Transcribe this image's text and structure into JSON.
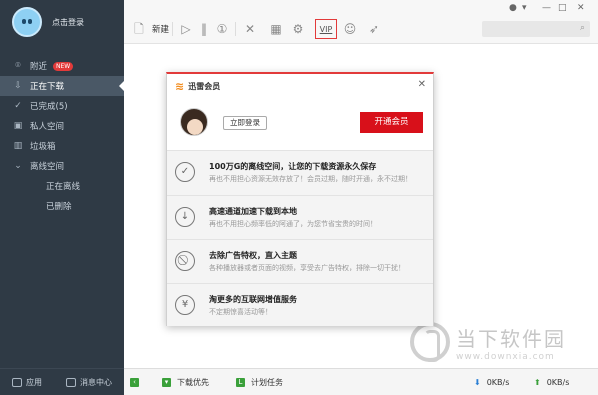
{
  "sidebar": {
    "login_label": "点击登录",
    "items": [
      {
        "label": "附近",
        "badge": "NEW",
        "icon": "location-icon"
      },
      {
        "label": "正在下载",
        "icon": "download-icon"
      },
      {
        "label": "已完成(5)",
        "icon": "check-icon"
      },
      {
        "label": "私人空间",
        "icon": "lock-icon"
      },
      {
        "label": "垃圾箱",
        "icon": "trash-icon"
      },
      {
        "label": "离线空间",
        "icon": "chevron-down-icon"
      },
      {
        "label": "正在离线"
      },
      {
        "label": "已删除"
      }
    ],
    "footer": {
      "apps_label": "应用",
      "messages_label": "消息中心"
    }
  },
  "toolbar": {
    "new_label": "新建",
    "vip_label": "VIP"
  },
  "statusbar": {
    "priority_label": "下载优先",
    "plan_label": "计划任务",
    "down_speed": "0KB/s",
    "up_speed": "0KB/s"
  },
  "watermark": {
    "title": "当下软件园",
    "url": "www.downxia.com"
  },
  "dialog": {
    "logo_text": "迅雷会员",
    "login_label": "立即登录",
    "open_vip_label": "开通会员",
    "features": [
      {
        "title": "100万G的离线空间，让您的下载资源永久保存",
        "desc": "再也不用担心资源无效存放了！会员过期，随时开通，永不过期！",
        "icon": "check-circle-icon"
      },
      {
        "title": "高速通道加速下载到本地",
        "desc": "再也不用担心频率低的阿通了，为您节省宝贵的时间！",
        "icon": "download-circle-icon"
      },
      {
        "title": "去除广告特权，直入主题",
        "desc": "各种播放器或者页面的视频，享受去广告特权，排除一切干扰！",
        "icon": "no-ads-icon"
      },
      {
        "title": "淘更多的互联网增值服务",
        "desc": "不定期惊喜活动等！",
        "icon": "yen-circle-icon"
      }
    ]
  }
}
